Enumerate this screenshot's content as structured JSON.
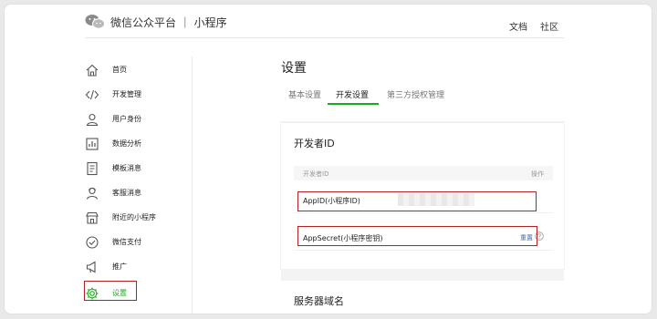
{
  "header": {
    "app_title": "微信公众平台 ｜ 小程序",
    "nav": {
      "docs": "文档",
      "community": "社区"
    }
  },
  "sidebar": {
    "items": [
      {
        "label": "首页",
        "icon": "home-icon"
      },
      {
        "label": "开发管理",
        "icon": "code-icon"
      },
      {
        "label": "用户身份",
        "icon": "user-icon"
      },
      {
        "label": "数据分析",
        "icon": "chart-icon"
      },
      {
        "label": "模板消息",
        "icon": "document-icon"
      },
      {
        "label": "客服消息",
        "icon": "customer-service-icon"
      },
      {
        "label": "附近的小程序",
        "icon": "store-icon"
      },
      {
        "label": "微信支付",
        "icon": "payment-icon"
      },
      {
        "label": "推广",
        "icon": "megaphone-icon"
      },
      {
        "label": "设置",
        "icon": "gear-icon",
        "active": true
      }
    ]
  },
  "main": {
    "title": "设置",
    "tabs": [
      {
        "label": "基本设置"
      },
      {
        "label": "开发设置",
        "active": true
      },
      {
        "label": "第三方授权管理"
      }
    ],
    "developer_section": {
      "title": "开发者ID",
      "table_header": {
        "id": "开发者ID",
        "op": "操作"
      },
      "rows": [
        {
          "label": "AppID(小程序ID)"
        },
        {
          "label": "AppSecret(小程序密钥)",
          "action": "重置"
        }
      ]
    },
    "server_section": {
      "title": "服务器域名"
    }
  },
  "colors": {
    "accent": "#1aad19",
    "highlight_border": "#b22222",
    "link": "#3e6fb4"
  }
}
